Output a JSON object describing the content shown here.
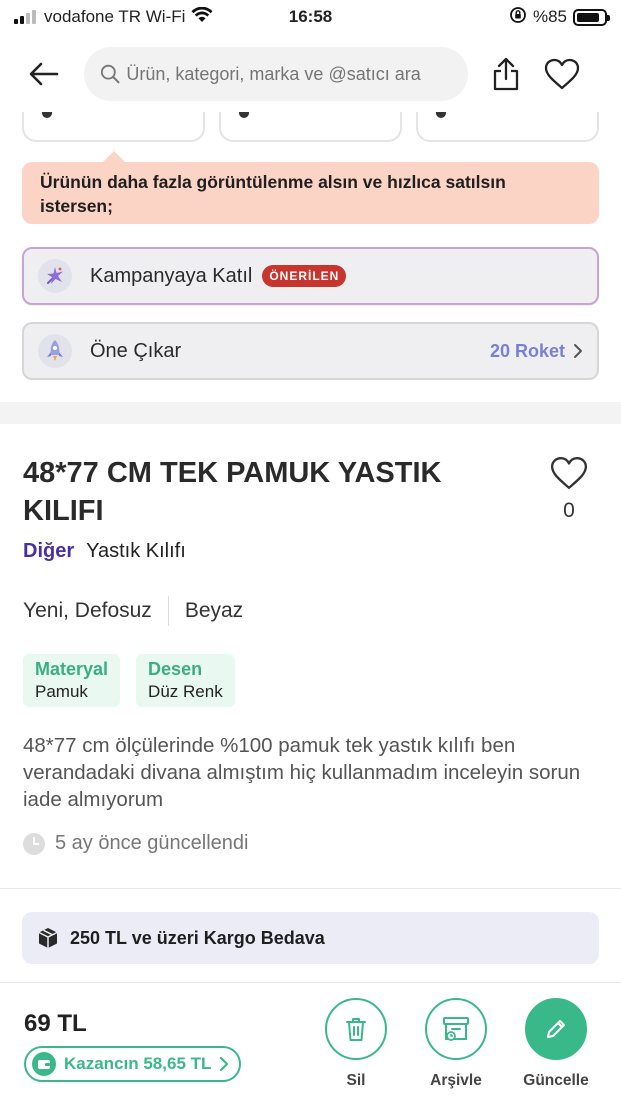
{
  "status_bar": {
    "carrier": "vodafone TR Wi-Fi",
    "time": "16:58",
    "battery": "%85",
    "battery_level": 0.85,
    "signal_bars": 2
  },
  "navbar": {
    "search_placeholder": "Ürün, kategori, marka ve @satıcı ara"
  },
  "promo": {
    "tip": "Ürünün daha fazla görüntülenme alsın ve hızlıca satılsın istersen;",
    "campaign_label": "Kampanyaya Katıl",
    "campaign_badge": "ÖNERİLEN",
    "boost_label": "Öne Çıkar",
    "boost_price": "20 Roket"
  },
  "product": {
    "title": "48*77 CM TEK PAMUK YASTIK KILIFI",
    "like_count": "0",
    "category": "Diğer",
    "subcategory": "Yastık Kılıfı",
    "condition": "Yeni, Defosuz",
    "color": "Beyaz",
    "attributes": [
      {
        "key": "Materyal",
        "value": "Pamuk"
      },
      {
        "key": "Desen",
        "value": "Düz Renk"
      }
    ],
    "description": "48*77 cm ölçülerinde %100 pamuk tek yastık kılıfı ben verandadaki divana almıştım hiç kullanmadım inceleyin sorun iade almıyorum",
    "updated": "5 ay önce güncellendi"
  },
  "shipping": {
    "text": "250 TL ve üzeri Kargo Bedava"
  },
  "bottom_bar": {
    "price": "69 TL",
    "earnings": "Kazancın 58,65 TL",
    "delete_label": "Sil",
    "archive_label": "Arşivle",
    "update_label": "Güncelle"
  },
  "colors": {
    "accent_green": "#39b98a",
    "brand_purple": "#4a2fa0",
    "badge_red": "#c8352e",
    "rocket_blue": "#7a7ed6",
    "tip_bg": "#fbd4c6"
  }
}
